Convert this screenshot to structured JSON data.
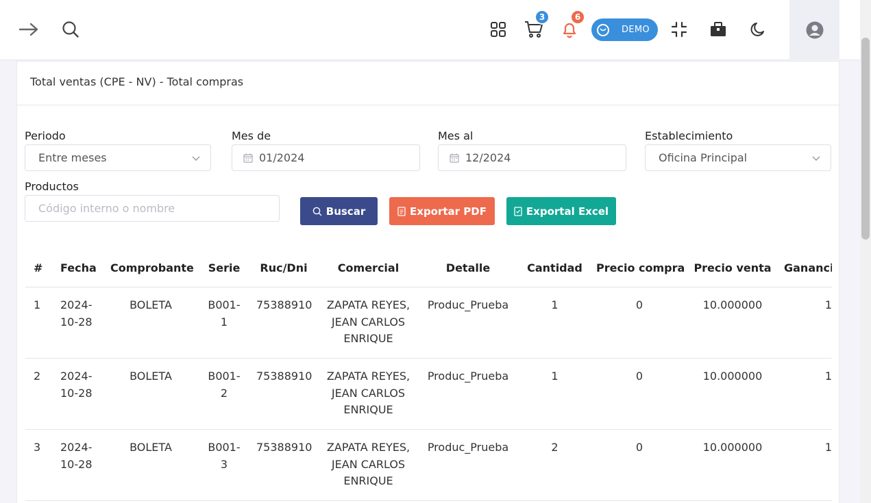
{
  "topbar": {
    "cart_count": "3",
    "notifications_count": "6",
    "demo_label": "DEMO"
  },
  "card": {
    "title": "Total ventas (CPE - NV) - Total compras"
  },
  "filters": {
    "periodo_label": "Periodo",
    "periodo_value": "Entre meses",
    "mes_de_label": "Mes de",
    "mes_de_value": "01/2024",
    "mes_al_label": "Mes al",
    "mes_al_value": "12/2024",
    "establecimiento_label": "Establecimiento",
    "establecimiento_value": "Oficina Principal",
    "productos_label": "Productos",
    "productos_placeholder": "Código interno o nombre"
  },
  "actions": {
    "buscar": "Buscar",
    "exportar_pdf": "Exportar PDF",
    "exportar_excel": "Exportal Excel"
  },
  "table": {
    "columns": [
      "#",
      "Fecha",
      "Comprobante",
      "Serie",
      "Ruc/Dni",
      "Comercial",
      "Detalle",
      "Cantidad",
      "Precio compra",
      "Precio venta",
      "Gananci"
    ],
    "rows": [
      {
        "num": "1",
        "fecha": "2024-10-28",
        "comprobante": "BOLETA",
        "serie": "B001-1",
        "ruc": "75388910",
        "comercial": "ZAPATA REYES, JEAN CARLOS ENRIQUE",
        "detalle": "Produc_Prueba",
        "cantidad": "1",
        "precio_compra": "0",
        "precio_venta": "10.000000",
        "ganancia": "1"
      },
      {
        "num": "2",
        "fecha": "2024-10-28",
        "comprobante": "BOLETA",
        "serie": "B001-2",
        "ruc": "75388910",
        "comercial": "ZAPATA REYES, JEAN CARLOS ENRIQUE",
        "detalle": "Produc_Prueba",
        "cantidad": "1",
        "precio_compra": "0",
        "precio_venta": "10.000000",
        "ganancia": "1"
      },
      {
        "num": "3",
        "fecha": "2024-10-28",
        "comprobante": "BOLETA",
        "serie": "B001-3",
        "ruc": "75388910",
        "comercial": "ZAPATA REYES, JEAN CARLOS ENRIQUE",
        "detalle": "Produc_Prueba",
        "cantidad": "2",
        "precio_compra": "0",
        "precio_venta": "10.000000",
        "ganancia": "1"
      }
    ]
  },
  "colors": {
    "buscar": "#3a4a8a",
    "pdf": "#ee6a4d",
    "excel": "#12a895",
    "cart_badge": "#3a8fdc",
    "notif_badge": "#ee6a4d"
  }
}
